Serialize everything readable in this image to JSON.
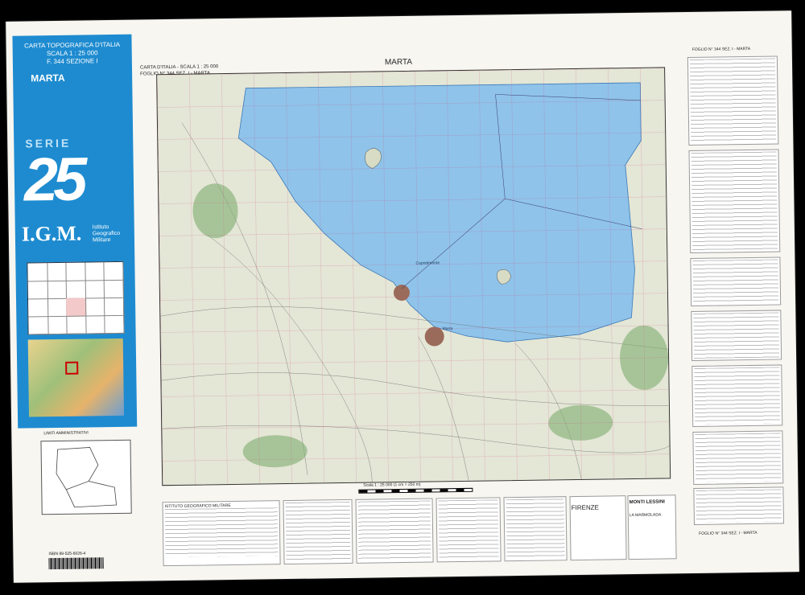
{
  "cover": {
    "line1": "CARTA TOPOGRAFICA D'ITALIA",
    "line2": "SCALA 1 : 25 000",
    "line3": "F. 344 SEZIONE I",
    "name": "MARTA",
    "serie": "SERIE",
    "big_number": "25",
    "igm": "I.G.M.",
    "igm_sub": "Istituto Geografico Militare"
  },
  "map": {
    "header_left_1": "CARTA D'ITALIA - SCALA 1 : 25 000",
    "header_left_2": "FOGLIO N° 344 SEZ. I - MARTA",
    "title": "MARTA",
    "scale_text": "Scala 1 : 25 000 (1 cm = 250 m)",
    "place_labels": [
      "Marta",
      "Capodimonte"
    ]
  },
  "bottom": {
    "institute": "ISTITUTO GEOGRAFICO MILITARE",
    "firenze": "FIRENZE",
    "monti_lessini": "MONTI LESSINI",
    "marmolada": "LA MARMOLADA",
    "isbn": "ISBN 88-525-6026-4",
    "admin_title": "LIMITI AMMINISTRATIVI"
  },
  "side": {
    "foglio_top": "FOGLIO N° 344 SEZ. I - MARTA",
    "foglio_bottom": "FOGLIO N° 344 SEZ. I - MARTA"
  },
  "colors": {
    "lake": "#8fc3ea",
    "cover": "#1e8bd0",
    "land": "#e4e6d6"
  }
}
